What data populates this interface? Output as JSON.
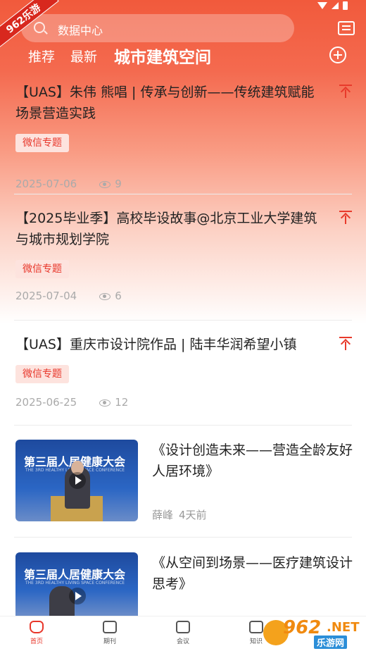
{
  "watermark": {
    "badge": "962乐游"
  },
  "search": {
    "placeholder": "数据中心"
  },
  "tabs": [
    {
      "label": "推荐"
    },
    {
      "label": "最新"
    },
    {
      "label": "城市建筑空间"
    }
  ],
  "articles": [
    {
      "title": "【UAS】朱伟 熊唱 | 传承与创新——传统建筑赋能场景营造实践",
      "tag": "微信专题",
      "date": "2025-07-06",
      "views": "9"
    },
    {
      "title": "【2025毕业季】高校毕设故事@北京工业大学建筑与城市规划学院",
      "tag": "微信专题",
      "date": "2025-07-04",
      "views": "6"
    },
    {
      "title": "【UAS】重庆市设计院作品 | 陆丰华润希望小镇",
      "tag": "微信专题",
      "date": "2025-06-25",
      "views": "12"
    }
  ],
  "videos": [
    {
      "title": "《设计创造未来——营造全龄友好人居环境》",
      "author": "薛峰",
      "time": "4天前",
      "thumb_caption": "第三届人居健康大会",
      "thumb_sub": "THE 3RD HEALTHY LIVING SPACE CONFERENCE"
    },
    {
      "title": "《从空间到场景——医疗建筑设计思考》",
      "author": "",
      "time": "",
      "thumb_caption": "第三届人居健康大会",
      "thumb_sub": "THE 3RD HEALTHY LIVING SPACE CONFERENCE"
    }
  ],
  "bottom_nav": [
    {
      "label": "首页",
      "icon": "home-icon"
    },
    {
      "label": "期刊",
      "icon": "book-icon"
    },
    {
      "label": "会议",
      "icon": "presentation-icon"
    },
    {
      "label": "知识",
      "icon": "graduation-cap-icon"
    }
  ],
  "brand": {
    "num": "962",
    "net": ".NET",
    "cn": "乐游网"
  },
  "colors": {
    "accent": "#e8362a",
    "header_top": "#f15a3c",
    "tag_bg": "#fde3de"
  }
}
